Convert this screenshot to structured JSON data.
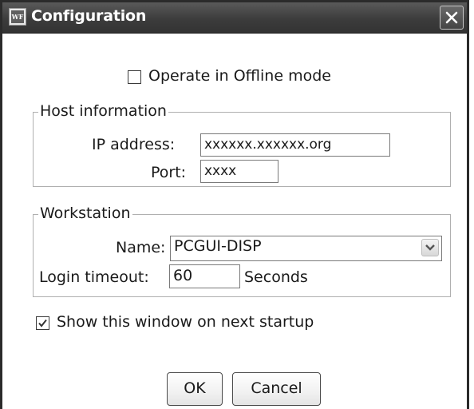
{
  "window": {
    "title": "Configuration",
    "app_icon_text": "WF"
  },
  "offline_mode": {
    "label": "Operate in Offline mode",
    "checked": false
  },
  "host_information": {
    "legend": "Host information",
    "ip_label": "IP address:",
    "ip_value": "xxxxxx.xxxxxx.org",
    "port_label": "Port:",
    "port_value": "xxxx"
  },
  "workstation": {
    "legend": "Workstation",
    "name_label": "Name:",
    "name_value": "PCGUI-DISP",
    "timeout_label": "Login timeout:",
    "timeout_value": "60",
    "timeout_unit": "Seconds"
  },
  "show_on_startup": {
    "label": "Show this window on next startup",
    "checked": true
  },
  "buttons": {
    "ok": "OK",
    "cancel": "Cancel"
  }
}
